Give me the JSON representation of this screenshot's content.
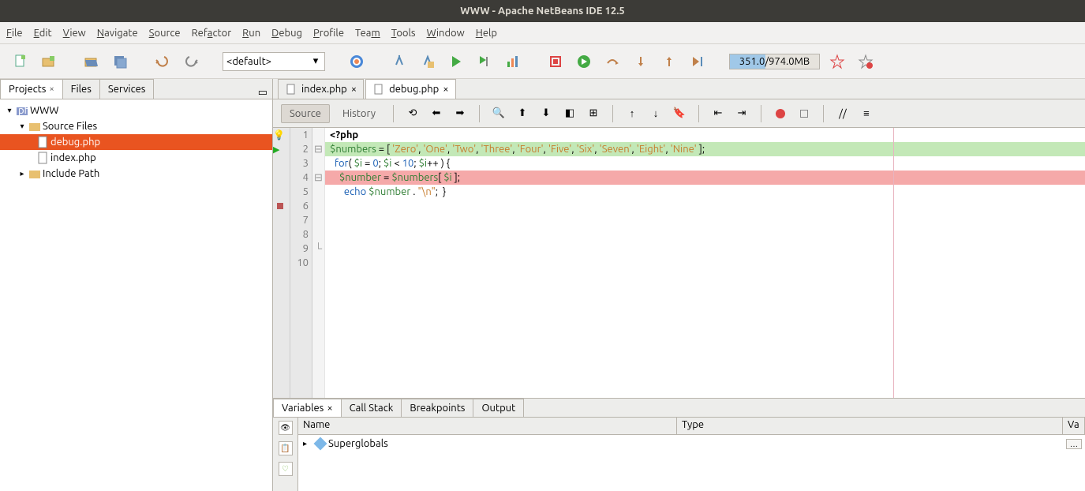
{
  "window": {
    "title": "WWW - Apache NetBeans IDE 12.5"
  },
  "menu": [
    "File",
    "Edit",
    "View",
    "Navigate",
    "Source",
    "Refactor",
    "Run",
    "Debug",
    "Profile",
    "Team",
    "Tools",
    "Window",
    "Help"
  ],
  "toolbar": {
    "config": "<default>",
    "memory": "351.0/974.0MB"
  },
  "left_tabs": [
    {
      "label": "Projects",
      "active": true,
      "closable": true
    },
    {
      "label": "Files",
      "active": false,
      "closable": false
    },
    {
      "label": "Services",
      "active": false,
      "closable": false
    }
  ],
  "tree": {
    "root": {
      "label": "WWW",
      "icon": "php-project"
    },
    "source_files": {
      "label": "Source Files"
    },
    "files": [
      {
        "label": "debug.php",
        "selected": true
      },
      {
        "label": "index.php",
        "selected": false
      }
    ],
    "include_path": {
      "label": "Include Path"
    }
  },
  "editor_tabs": [
    {
      "label": "index.php",
      "active": false
    },
    {
      "label": "debug.php",
      "active": true
    }
  ],
  "editor_toolbar": {
    "source": "Source",
    "history": "History"
  },
  "code": {
    "lines": [
      {
        "n": 1,
        "glyph": "bulb",
        "fold": "",
        "html": "<span class='k-tag'>&lt;?php</span>",
        "cls": ""
      },
      {
        "n": 2,
        "glyph": "arrow",
        "fold": "⊟",
        "html": "<span class='k-var'>$numbers</span> <span class='k-op'>=</span> [ <span class='k-str'>'Zero'</span>, <span class='k-str'>'One'</span>, <span class='k-str'>'Two'</span>, <span class='k-str'>'Three'</span>, <span class='k-str'>'Four'</span>, <span class='k-str'>'Five'</span>, <span class='k-str'>'Six'</span>, <span class='k-str'>'Seven'</span>, <span class='k-str'>'Eight'</span>, <span class='k-str'>'Nine'</span> ];",
        "cls": "hl-green"
      },
      {
        "n": 3,
        "glyph": "",
        "fold": "",
        "html": "",
        "cls": ""
      },
      {
        "n": 4,
        "glyph": "",
        "fold": "⊟",
        "html": "<span class='k-kw'>for</span>( <span class='k-var'>$i</span> <span class='k-op'>=</span> <span class='k-num'>0</span>; <span class='k-var'>$i</span> <span class='k-op'>&lt;</span> <span class='k-num'>10</span>; <span class='k-var'>$i</span><span class='k-op'>++</span> ) {",
        "cls": ""
      },
      {
        "n": 5,
        "glyph": "",
        "fold": "",
        "html": "",
        "cls": ""
      },
      {
        "n": 6,
        "glyph": "bp",
        "fold": "",
        "html": "    <span class='k-var'>$number</span> <span class='k-op'>=</span> <span class='k-var'>$numbers</span>[ <span class='k-var'>$i</span> ];",
        "cls": "hl-red"
      },
      {
        "n": 7,
        "glyph": "",
        "fold": "",
        "html": "",
        "cls": ""
      },
      {
        "n": 8,
        "glyph": "",
        "fold": "",
        "html": "    <span class='k-kw'>echo</span> <span class='k-var'>$number</span> <span class='k-op'>.</span> <span class='k-str'>\"\\n\"</span>;",
        "cls": ""
      },
      {
        "n": 9,
        "glyph": "",
        "fold": "└",
        "html": "}",
        "cls": ""
      },
      {
        "n": 10,
        "glyph": "",
        "fold": "",
        "html": "",
        "cls": ""
      }
    ]
  },
  "bottom_tabs": [
    {
      "label": "Variables",
      "active": true,
      "closable": true
    },
    {
      "label": "Call Stack",
      "active": false
    },
    {
      "label": "Breakpoints",
      "active": false
    },
    {
      "label": "Output",
      "active": false
    }
  ],
  "vars_header": {
    "name": "Name",
    "type": "Type",
    "value": "Va"
  },
  "vars_rows": [
    {
      "label": "Superglobals"
    }
  ]
}
